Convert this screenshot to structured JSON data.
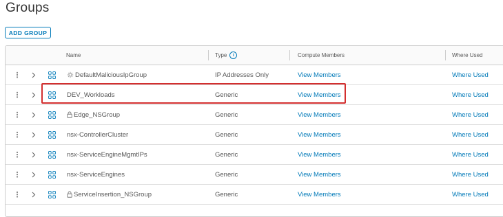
{
  "page": {
    "title": "Groups"
  },
  "toolbar": {
    "add_group_label": "ADD GROUP"
  },
  "table": {
    "headers": {
      "name": "Name",
      "type": "Type",
      "compute_members": "Compute Members",
      "where_used": "Where Used"
    },
    "rows": [
      {
        "name": "DefaultMaliciousIpGroup",
        "type": "IP Addresses Only",
        "members": "View Members",
        "where_used": "Where Used",
        "icon": "shield-gear-icon"
      },
      {
        "name": "DEV_Workloads",
        "type": "Generic",
        "members": "View Members",
        "where_used": "Where Used",
        "icon": "",
        "highlighted": true
      },
      {
        "name": "Edge_NSGroup",
        "type": "Generic",
        "members": "View Members",
        "where_used": "Where Used",
        "icon": "lock-icon"
      },
      {
        "name": "nsx-ControllerCluster",
        "type": "Generic",
        "members": "View Members",
        "where_used": "Where Used",
        "icon": ""
      },
      {
        "name": "nsx-ServiceEngineMgmtIPs",
        "type": "Generic",
        "members": "View Members",
        "where_used": "Where Used",
        "icon": ""
      },
      {
        "name": "nsx-ServiceEngines",
        "type": "Generic",
        "members": "View Members",
        "where_used": "Where Used",
        "icon": ""
      },
      {
        "name": "ServiceInsertion_NSGroup",
        "type": "Generic",
        "members": "View Members",
        "where_used": "Where Used",
        "icon": "lock-icon"
      }
    ]
  },
  "colors": {
    "accent": "#0079b8",
    "highlight": "#d32f2f"
  }
}
